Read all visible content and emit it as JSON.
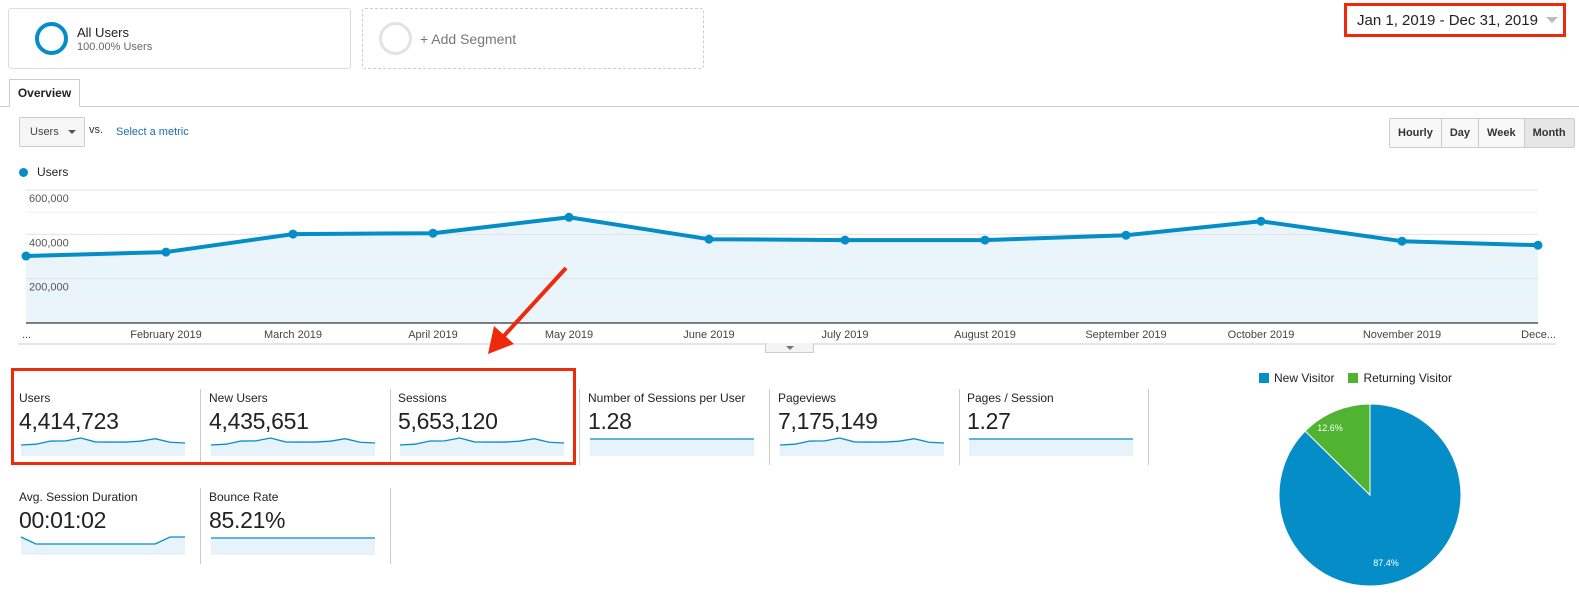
{
  "segments": {
    "all_users": {
      "title": "All Users",
      "subtitle": "100.00% Users"
    },
    "add_segment": {
      "label": "+ Add Segment"
    }
  },
  "date_range": {
    "label": "Jan 1, 2019 - Dec 31, 2019"
  },
  "tabs": [
    {
      "label": "Overview",
      "active": true
    }
  ],
  "metric_selector": {
    "selected": "Users",
    "vs_label": "vs.",
    "compare_link": "Select a metric"
  },
  "granularity": {
    "options": [
      "Hourly",
      "Day",
      "Week",
      "Month"
    ],
    "selected": "Month"
  },
  "colors": {
    "primary": "#058dc7",
    "area_fill": "#e6f3fa",
    "secondary": "#50b432",
    "highlight": "#ee2a0c"
  },
  "chart_data": [
    {
      "type": "area",
      "title": "",
      "legend": [
        "Users"
      ],
      "legend_placement": "top-left",
      "x": [
        "...",
        "February 2019",
        "March 2019",
        "April 2019",
        "May 2019",
        "June 2019",
        "July 2019",
        "August 2019",
        "September 2019",
        "October 2019",
        "November 2019",
        "Dece..."
      ],
      "series": [
        {
          "name": "Users",
          "values": [
            302000,
            320000,
            401000,
            405000,
            477000,
            378000,
            374000,
            374000,
            396000,
            459000,
            369000,
            351000
          ]
        }
      ],
      "ylim": [
        0,
        600000
      ],
      "yticks": [
        "200,000",
        "400,000",
        "600,000"
      ],
      "grid": true,
      "xlabel": "",
      "ylabel": ""
    },
    {
      "type": "pie",
      "legend": [
        "New Visitor",
        "Returning Visitor"
      ],
      "legend_placement": "top",
      "slices": [
        {
          "label": "New Visitor",
          "value": 87.4,
          "display": "87.4%",
          "color": "#058dc7"
        },
        {
          "label": "Returning Visitor",
          "value": 12.6,
          "display": "12.6%",
          "color": "#50b432"
        }
      ]
    }
  ],
  "kpis": [
    {
      "label": "Users",
      "value": "4,414,723",
      "spark": [
        3.0,
        3.2,
        4.0,
        4.05,
        4.77,
        3.78,
        3.74,
        3.74,
        3.96,
        4.59,
        3.69,
        3.51
      ]
    },
    {
      "label": "New Users",
      "value": "4,435,651",
      "spark": [
        3.0,
        3.2,
        4.0,
        4.05,
        4.77,
        3.78,
        3.74,
        3.74,
        3.96,
        4.59,
        3.69,
        3.51
      ]
    },
    {
      "label": "Sessions",
      "value": "5,653,120",
      "spark": [
        3.0,
        3.2,
        4.0,
        4.05,
        4.77,
        3.78,
        3.74,
        3.74,
        3.96,
        4.59,
        3.69,
        3.51
      ]
    },
    {
      "label": "Number of Sessions per User",
      "value": "1.28",
      "spark": [
        1.28,
        1.28,
        1.28,
        1.28,
        1.28,
        1.28,
        1.28,
        1.28,
        1.28,
        1.28,
        1.28,
        1.28
      ]
    },
    {
      "label": "Pageviews",
      "value": "7,175,149",
      "spark": [
        3.0,
        3.2,
        4.0,
        4.05,
        4.77,
        3.78,
        3.74,
        3.74,
        3.96,
        4.59,
        3.69,
        3.51
      ]
    },
    {
      "label": "Pages / Session",
      "value": "1.27",
      "spark": [
        1.27,
        1.27,
        1.27,
        1.27,
        1.27,
        1.27,
        1.27,
        1.27,
        1.27,
        1.27,
        1.27,
        1.27
      ]
    },
    {
      "label": "Avg. Session Duration",
      "value": "00:01:02",
      "spark": [
        62,
        61,
        61,
        61,
        61,
        61,
        61,
        61,
        61,
        61,
        62,
        62
      ]
    },
    {
      "label": "Bounce Rate",
      "value": "85.21%",
      "spark": [
        85.2,
        85.2,
        85.2,
        85.2,
        85.2,
        85.2,
        85.2,
        85.2,
        85.2,
        85.2,
        85.2,
        85.2
      ]
    }
  ]
}
